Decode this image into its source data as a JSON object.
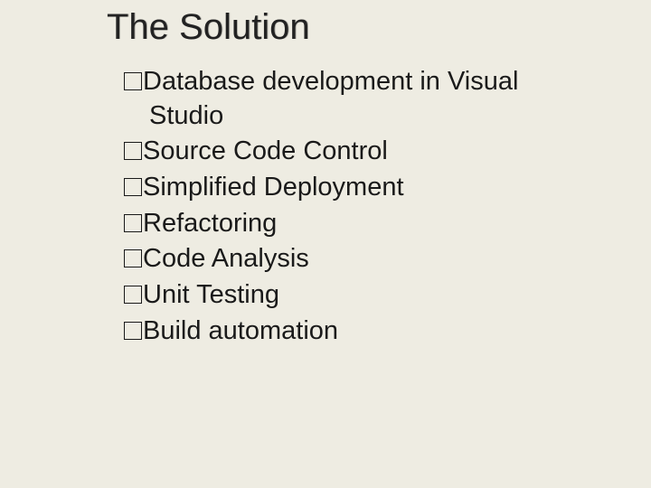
{
  "title": "The Solution",
  "items": [
    "Database development in Visual Studio",
    "Source Code Control",
    "Simplified Deployment",
    "Refactoring",
    "Code Analysis",
    "Unit Testing",
    "Build automation"
  ]
}
